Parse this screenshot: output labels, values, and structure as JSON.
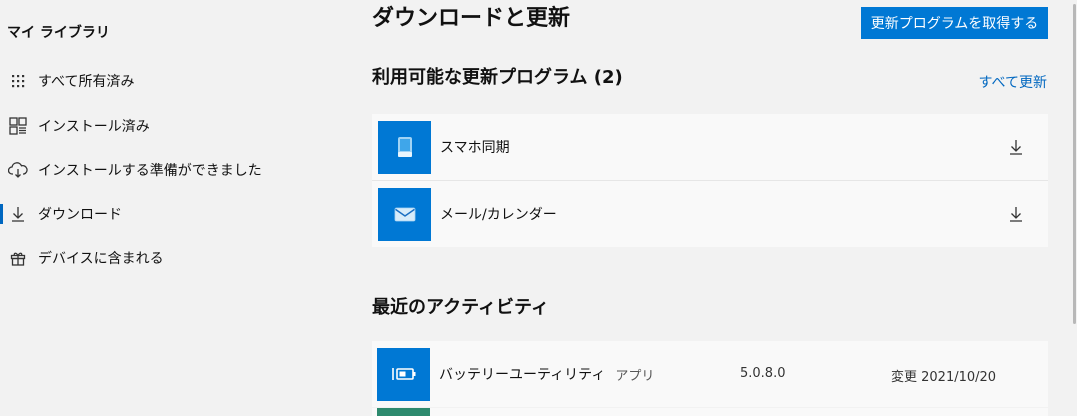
{
  "sidebar": {
    "title": "マイ ライブラリ",
    "items": [
      {
        "label": "すべて所有済み",
        "icon": "grid-dots-icon"
      },
      {
        "label": "インストール済み",
        "icon": "installed-grid-icon"
      },
      {
        "label": "インストールする準備ができました",
        "icon": "cloud-download-icon"
      },
      {
        "label": "ダウンロード",
        "icon": "download-arrow-icon",
        "selected": true
      },
      {
        "label": "デバイスに含まれる",
        "icon": "gift-icon"
      }
    ]
  },
  "main": {
    "title": "ダウンロードと更新",
    "get_updates_button": "更新プログラムを取得する",
    "updates": {
      "heading": "利用可能な更新プログラム (2)",
      "update_all_link": "すべて更新",
      "items": [
        {
          "name": "スマホ同期",
          "icon": "phone-link-icon"
        },
        {
          "name": "メール/カレンダー",
          "icon": "mail-icon"
        }
      ]
    },
    "activity": {
      "heading": "最近のアクティビティ",
      "items": [
        {
          "name": "バッテリーユーティリティ",
          "type": "アプリ",
          "version": "5.0.8.0",
          "modified": "変更 2021/10/20",
          "icon": "battery-utility-icon"
        }
      ]
    }
  },
  "colors": {
    "accent": "#0078d4",
    "link": "#0067c0",
    "background": "#f2f2f2",
    "card": "#f9f9f9"
  }
}
